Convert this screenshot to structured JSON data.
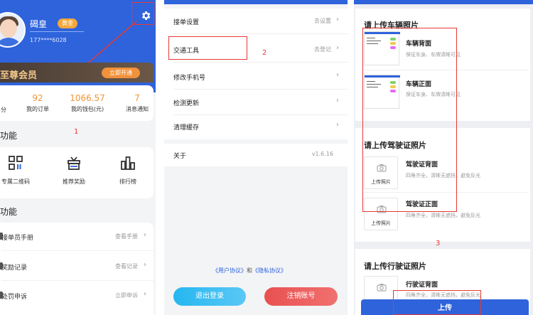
{
  "profile": {
    "username": "碣皇",
    "level_badge": "黄金",
    "phone": "177****6028",
    "vip_text": "至尊会员",
    "vip_button": "立即开通"
  },
  "stats": [
    {
      "value": "",
      "label": "分"
    },
    {
      "value": "92",
      "label": "我的订单"
    },
    {
      "value": "1066.57",
      "label": "我的钱包(元)"
    },
    {
      "value": "7",
      "label": "消息通知"
    }
  ],
  "section_features_title": "功能",
  "features": [
    {
      "label": "专属二维码",
      "icon": "qr-code-icon"
    },
    {
      "label": "推荐奖励",
      "icon": "gift-icon"
    },
    {
      "label": "排行榜",
      "icon": "ranking-icon"
    }
  ],
  "section_tools_title": "功能",
  "menu": [
    {
      "title": "接单员手册",
      "action": "查看手册"
    },
    {
      "title": "奖励记录",
      "action": "查看记录"
    },
    {
      "title": "处罚申诉",
      "action": "立即申诉"
    }
  ],
  "settings": [
    {
      "title": "接单设置",
      "action": "去设置"
    },
    {
      "title": "交通工具",
      "action": "去登记"
    },
    {
      "title": "修改手机号",
      "action": ""
    },
    {
      "title": "检测更新",
      "action": ""
    },
    {
      "title": "清理缓存",
      "action": ""
    }
  ],
  "about": {
    "title": "关于",
    "version": "v1.6.16"
  },
  "agreement": {
    "user": "《用户协议》",
    "and": "和",
    "privacy": "《隐私协议》"
  },
  "logout_button": "退出登录",
  "cancel_account_button": "注销账号",
  "upload": {
    "vehicle_section_title": "请上传车辆照片",
    "vehicle_items": [
      {
        "title": "车辆背面",
        "desc": "保证车身、车牌清晰可见"
      },
      {
        "title": "车辆正面",
        "desc": "保证车身、车牌清晰可见"
      }
    ],
    "license_section_title": "请上传驾驶证照片",
    "license_items": [
      {
        "title": "驾驶证背面",
        "desc": "四角齐全，清晰无遮挡，避免反光"
      },
      {
        "title": "驾驶证正面",
        "desc": "四角齐全，清晰无遮挡，避免反光"
      }
    ],
    "upload_photo_label": "上传照片",
    "vehicle_license_section_title": "请上传行驶证照片",
    "vehicle_license_items": [
      {
        "title": "行驶证背面",
        "desc": "四角齐全，清晰无遮挡，避免反光"
      }
    ],
    "submit_button": "上传"
  },
  "annotations": {
    "one": "1",
    "two": "2",
    "three": "3"
  },
  "colors": {
    "primary": "#2e63dc",
    "orange": "#f09538",
    "annotation": "#e53935"
  }
}
